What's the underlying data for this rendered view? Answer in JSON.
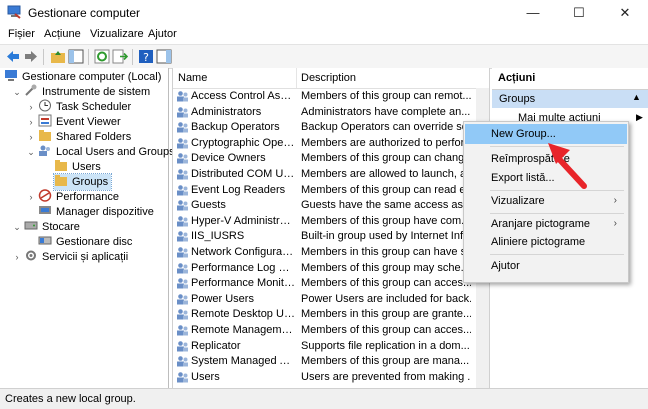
{
  "window": {
    "title": "Gestionare computer",
    "controls": {
      "minimize": "—",
      "maximize": "☐",
      "close": "✕"
    }
  },
  "menubar": [
    "Fișier",
    "Acțiune",
    "Vizualizare",
    "Ajutor"
  ],
  "tree": {
    "root": "Gestionare computer (Local)",
    "system_tools": "Instrumente de sistem",
    "task_scheduler": "Task Scheduler",
    "event_viewer": "Event Viewer",
    "shared_folders": "Shared Folders",
    "local_users_groups": "Local Users and Groups",
    "users": "Users",
    "groups": "Groups",
    "performance": "Performance",
    "device_manager": "Manager dispozitive",
    "storage": "Stocare",
    "disk_management": "Gestionare disc",
    "services_apps": "Servicii și aplicații"
  },
  "list": {
    "columns": [
      "Name",
      "Description"
    ],
    "rows": [
      {
        "name": "Access Control Assist...",
        "desc": "Members of this group can remot..."
      },
      {
        "name": "Administrators",
        "desc": "Administrators have complete an..."
      },
      {
        "name": "Backup Operators",
        "desc": "Backup Operators can override se..."
      },
      {
        "name": "Cryptographic Operat...",
        "desc": "Members are authorized to perfor..."
      },
      {
        "name": "Device Owners",
        "desc": "Members of this group can chang..."
      },
      {
        "name": "Distributed COM Users",
        "desc": "Members are allowed to launch, a..."
      },
      {
        "name": "Event Log Readers",
        "desc": "Members of this group can read e..."
      },
      {
        "name": "Guests",
        "desc": "Guests have the same access as m..."
      },
      {
        "name": "Hyper-V Administrators",
        "desc": "Members of this group have com..."
      },
      {
        "name": "IIS_IUSRS",
        "desc": "Built-in group used by Internet Inf..."
      },
      {
        "name": "Network Configuratio...",
        "desc": "Members in this group can have s..."
      },
      {
        "name": "Performance Log Users",
        "desc": "Members of this group may sche..."
      },
      {
        "name": "Performance Monitor ...",
        "desc": "Members of this group can acces..."
      },
      {
        "name": "Power Users",
        "desc": "Power Users are included for back..."
      },
      {
        "name": "Remote Desktop Users",
        "desc": "Members in this group are grante..."
      },
      {
        "name": "Remote Management...",
        "desc": "Members of this group can acces..."
      },
      {
        "name": "Replicator",
        "desc": "Supports file replication in a dom..."
      },
      {
        "name": "System Managed Acc...",
        "desc": "Members of this group are mana..."
      },
      {
        "name": "Users",
        "desc": "Users are prevented from making ..."
      }
    ]
  },
  "actions": {
    "header": "Acțiuni",
    "section": "Groups",
    "more": "Mai multe acțiuni"
  },
  "context_menu": {
    "items": [
      "New Group...",
      "Reîmprospătare",
      "Export listă...",
      "Vizualizare",
      "Aranjare pictograme",
      "Aliniere pictograme",
      "Ajutor"
    ]
  },
  "status": "Creates a new local group.",
  "colors": {
    "accent": "#0078d7",
    "selection": "#cce4f7",
    "highlight": "#91c9f7",
    "arrow": "#e8252a"
  }
}
